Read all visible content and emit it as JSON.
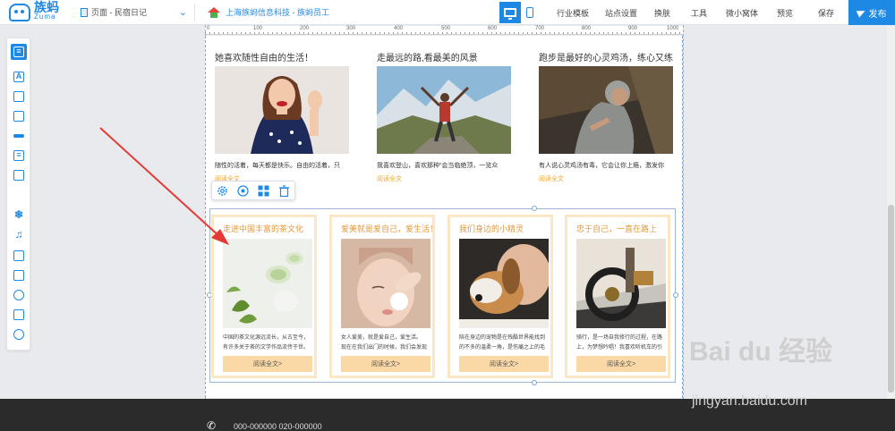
{
  "brand": {
    "name_cn": "族蚂",
    "name_en": "Zuma"
  },
  "topbar": {
    "page_select": "页面 - 民宿日记",
    "site_name": "上海族蚂信息科技 - 族蚂员工",
    "menu": [
      "行业模板",
      "站点设置",
      "换肤",
      "工具",
      "微小窝体",
      "预览",
      "保存"
    ],
    "publish": "发布"
  },
  "ruler": {
    "ticks": [
      "0",
      "100",
      "200",
      "300",
      "400",
      "500",
      "600",
      "700",
      "800",
      "900",
      "1000"
    ]
  },
  "sidebar_tools": [
    "list-module",
    "text",
    "image-text",
    "gallery",
    "divider",
    "list",
    "slideshow",
    "snowflake",
    "music",
    "video",
    "form",
    "disk",
    "picture",
    "search"
  ],
  "top_row": [
    {
      "title": "她喜欢随性自由的生活！",
      "desc": "随性的活着，每天都是快乐。自由的活着，只",
      "more": "阅读全文"
    },
    {
      "title": "走最远的路,看最美的风景",
      "desc": "我喜欢登山，喜欢那种“会当临绝顶，一览众",
      "more": "阅读全文"
    },
    {
      "title": "跑步是最好的心灵鸡汤，练心又练身",
      "desc": "有人说心灵鸡汤有毒，它会让你上瘾，激发你",
      "more": "阅读全文"
    }
  ],
  "cards": [
    {
      "title": "走进中国丰富的茶文化",
      "line1": "中国的茶文化源远流长，从古至今，",
      "line2": "有许多关于茶的文学作品流传于世。",
      "btn": "阅读全文>"
    },
    {
      "title": "爱美就是爱自己，爱生活！",
      "line1": "女人爱美，就是爱自己，爱生活。",
      "line2": "现在在我们出门的时候，我们会发现",
      "btn": "阅读全文>"
    },
    {
      "title": "我们身边的小精灵",
      "line1": "陪在身边的宠物是在残酷世界能找到",
      "line2": "的不多的温柔一角，是伤痛之上的毛",
      "btn": "阅读全文>"
    },
    {
      "title": "忠于自己，一直在路上",
      "line1": "骑行，是一场自我修行的过程，在路",
      "line2": "上，为梦想吟唱！我喜欢听机车的引",
      "btn": "阅读全文>"
    }
  ],
  "footer": {
    "phones": "000-000000   020-000000"
  },
  "watermark": {
    "logo": "Bai du 经验",
    "url": "jingyan.baidu.com"
  },
  "colors": {
    "accent": "#1e88e5",
    "orange": "#f5a623",
    "card_border": "#fbe6c6",
    "btn": "#fbd9a6"
  }
}
